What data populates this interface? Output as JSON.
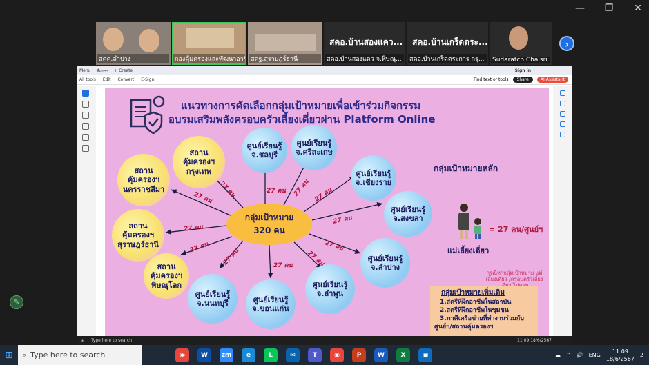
{
  "window_controls": {
    "minimize": "—",
    "restore": "❐",
    "close": "✕"
  },
  "participants": [
    {
      "label": "สคค.ลำปาง"
    },
    {
      "label": "กองคุ้มครองและพัฒนาอาชีพ"
    },
    {
      "label": "สคฐ.สุราษฎร์ธานี"
    },
    {
      "big": "สคอ.บ้านสองแคว...",
      "label": "สคอ.บ้านสองแคว จ.พิษณุ..."
    },
    {
      "big": "สคอ.บ้านเกร็ดตระ...",
      "label": "สคอ.บ้านเกร็ดตระการ กรุ..."
    },
    {
      "label": "Sudaratch Chaisri"
    }
  ],
  "next_button": "›",
  "pdf": {
    "tab_menu": "Menu",
    "tab_title": "ชื่อกรร",
    "new_tab": "+ Create",
    "sign_in": "Sign in",
    "tools": [
      "All tools",
      "Edit",
      "Convert",
      "E-Sign"
    ],
    "find": "Find text or tools",
    "share": "Share",
    "ai": "AI Assistant"
  },
  "slide": {
    "title_line1": "แนวทางการคัดเลือกกลุ่มเป้าหมายเพื่อเข้าร่วมกิจกรรม",
    "title_line2": "อบรมเสริมพลังครอบครัวเลี้ยงเดี่ยวผ่าน Platform Online",
    "center_line1": "กลุ่มเป้าหมาย",
    "center_line2": "320 คน",
    "spoke_label": "27 คน",
    "nodes": [
      {
        "line1": "ศูนย์เรียนรู้",
        "line2": "จ.ชลบุรี"
      },
      {
        "line1": "ศูนย์เรียนรู้",
        "line2": "จ.ศรีสะเกษ"
      },
      {
        "line1": "ศูนย์เรียนรู้",
        "line2": "จ.เชียงราย"
      },
      {
        "line1": "ศูนย์เรียนรู้",
        "line2": "จ.สงขลา"
      },
      {
        "line1": "ศูนย์เรียนรู้",
        "line2": "จ.ลำปาง"
      },
      {
        "line1": "ศูนย์เรียนรู้",
        "line2": "จ.ลำพูน"
      },
      {
        "line1": "ศูนย์เรียนรู้",
        "line2": "จ.ขอนแก่น"
      },
      {
        "line1": "ศูนย์เรียนรู้",
        "line2": "จ.นนทบุรี"
      },
      {
        "line1": "สถาน",
        "line2": "คุ้มครองฯ",
        "line3": "พิษณุโลก"
      },
      {
        "line1": "สถาน",
        "line2": "คุ้มครองฯ",
        "line3": "สุราษฎร์ธานี"
      },
      {
        "line1": "สถาน",
        "line2": "คุ้มครองฯ",
        "line3": "นครราชสีมา"
      },
      {
        "line1": "สถาน",
        "line2": "คุ้มครองฯ",
        "line3": "กรุงเทพ"
      }
    ],
    "main_group_title": "กลุ่มเป้าหมายหลัก",
    "ratio": "= 27 คน/ศูนย์ฯ",
    "single_mother": "แม่เลี้ยงเดี่ยว",
    "note": "กรณีหากลุ่มเป้าหมาย แม่เลี้ยงเดี่ยว /ครอบครัวเลี้ยงเดี่ยว ไม่ครบ",
    "extra_title": "กลุ่มเป้าหมายเพิ่มเติม",
    "extra_items": [
      "1.สตรีที่ฝึกอาชีพในสถาบัน",
      "2.สตรีที่ฝึกอาชีพในชุมชน",
      "3.ภาคีเครือข่ายที่ทำงานร่วมกับ",
      "ศูนย์ฯ/สถานคุ้มครองฯ"
    ]
  },
  "inner_taskbar": {
    "search": "Type here to search",
    "time": "11:09",
    "date": "18/6/2567"
  },
  "taskbar": {
    "search_placeholder": "Type here to search",
    "apps": [
      {
        "name": "chrome",
        "glyph": "◉",
        "color": "#e8453c"
      },
      {
        "name": "webex",
        "glyph": "W",
        "color": "#0b4ea2"
      },
      {
        "name": "zoom",
        "glyph": "zm",
        "color": "#2d8cff"
      },
      {
        "name": "edge",
        "glyph": "e",
        "color": "#1b8ad6"
      },
      {
        "name": "line",
        "glyph": "L",
        "color": "#06c755"
      },
      {
        "name": "mail",
        "glyph": "✉",
        "color": "#0a64ad"
      },
      {
        "name": "teams",
        "glyph": "T",
        "color": "#5059c9"
      },
      {
        "name": "chrome2",
        "glyph": "◉",
        "color": "#e8453c"
      },
      {
        "name": "powerpoint",
        "glyph": "P",
        "color": "#c43e1c"
      },
      {
        "name": "word",
        "glyph": "W",
        "color": "#185abd"
      },
      {
        "name": "excel",
        "glyph": "X",
        "color": "#107c41"
      },
      {
        "name": "photos",
        "glyph": "▣",
        "color": "#0f6cbd"
      }
    ],
    "lang": "ENG",
    "time": "11:09",
    "date": "18/6/2567",
    "notifications": "2"
  }
}
